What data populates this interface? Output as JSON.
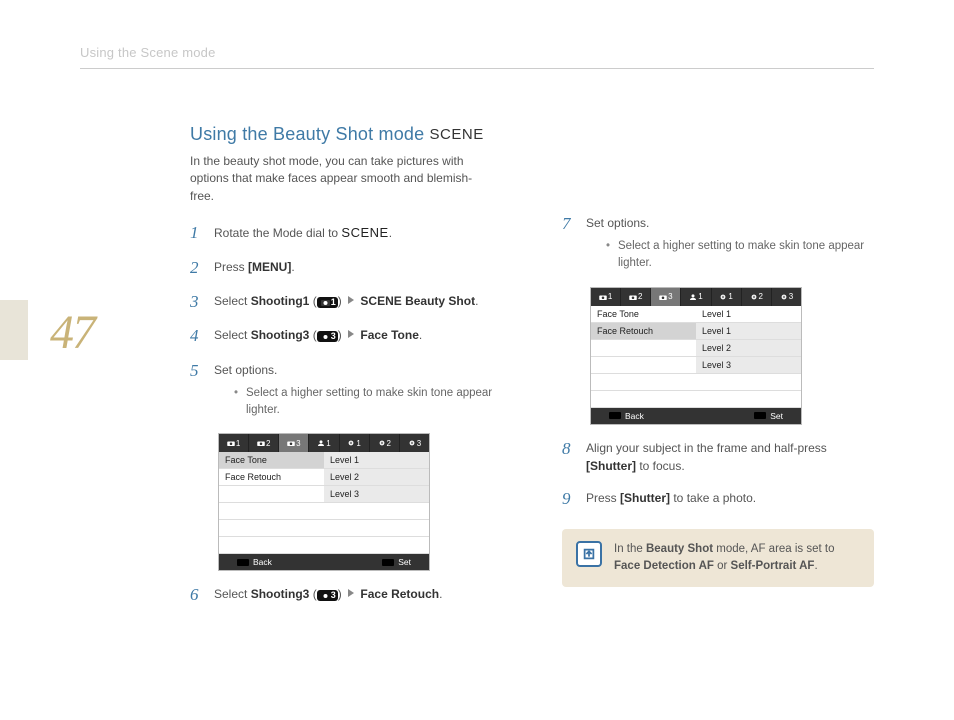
{
  "page_number": "47",
  "running_header": "Using the Scene mode",
  "title": "Using the Beauty Shot mode",
  "title_badge": "SCENE",
  "intro": "In the beauty shot mode, you can take pictures with options that make faces appear smooth and blemish-free.",
  "steps_left": {
    "s1": {
      "num": "1",
      "pre": "Rotate the Mode dial to ",
      "badge": "SCENE",
      "post": "."
    },
    "s2": {
      "num": "2",
      "pre": "Press ",
      "bold": "[MENU]",
      "post": "."
    },
    "s3": {
      "num": "3",
      "pre": "Select ",
      "bold": "Shooting1",
      "paren_open": " (",
      "icon_suffix": "1",
      "paren_close": ") ",
      "arrow": true,
      "bold2": "SCENE Beauty Shot",
      "post": "."
    },
    "s4": {
      "num": "4",
      "pre": "Select ",
      "bold": "Shooting3",
      "paren_open": " (",
      "icon_suffix": "3",
      "paren_close": ") ",
      "arrow": true,
      "bold2": "Face Tone",
      "post": "."
    },
    "s5": {
      "num": "5",
      "text": "Set options.",
      "bullet": "Select a higher setting to make skin tone appear lighter."
    },
    "s6": {
      "num": "6",
      "pre": "Select ",
      "bold": "Shooting3",
      "paren_open": " (",
      "icon_suffix": "3",
      "paren_close": ") ",
      "arrow": true,
      "bold2": "Face Retouch",
      "post": "."
    }
  },
  "steps_right": {
    "s7": {
      "num": "7",
      "text": "Set options.",
      "bullet": "Select a higher setting to make skin tone appear lighter."
    },
    "s8": {
      "num": "8",
      "pre": "Align your subject in the frame and half-press ",
      "bold": "[Shutter]",
      "post": " to focus."
    },
    "s9": {
      "num": "9",
      "pre": "Press ",
      "bold": "[Shutter]",
      "post": " to take a photo."
    }
  },
  "ui_mock_left": {
    "tabs_icons": [
      "camera",
      "camera",
      "camera",
      "person",
      "gear",
      "gear",
      "gear"
    ],
    "tabs_nums": [
      "1",
      "2",
      "3",
      "1",
      "1",
      "2",
      "3"
    ],
    "selected_tab_index": 2,
    "left_rows": [
      "Face Tone",
      "Face Retouch",
      "",
      "",
      "",
      ""
    ],
    "left_highlight_index": 0,
    "right_rows": [
      "Level 1",
      "Level 2",
      "Level 3",
      "",
      "",
      ""
    ],
    "right_dim_rows": [
      0,
      1,
      2
    ],
    "right_highlight_index": 1,
    "footer_back": "Back",
    "footer_set": "Set"
  },
  "ui_mock_right": {
    "tabs_icons": [
      "camera",
      "camera",
      "camera",
      "person",
      "gear",
      "gear",
      "gear"
    ],
    "tabs_nums": [
      "1",
      "2",
      "3",
      "1",
      "1",
      "2",
      "3"
    ],
    "selected_tab_index": 2,
    "left_rows": [
      "Face Tone",
      "Face Retouch",
      "",
      "",
      "",
      ""
    ],
    "left_highlight_index": 1,
    "right_rows": [
      "Level 1",
      "Level 1",
      "Level 2",
      "Level 3",
      "",
      ""
    ],
    "right_dim_rows": [
      1,
      2,
      3
    ],
    "right_highlight_index": 2,
    "footer_back": "Back",
    "footer_set": "Set"
  },
  "note": {
    "pre": "In the ",
    "b1": "Beauty Shot",
    "mid": " mode, AF area is set to ",
    "b2": "Face Detection AF",
    "mid2": " or ",
    "b3": "Self-Portrait AF",
    "post": "."
  }
}
